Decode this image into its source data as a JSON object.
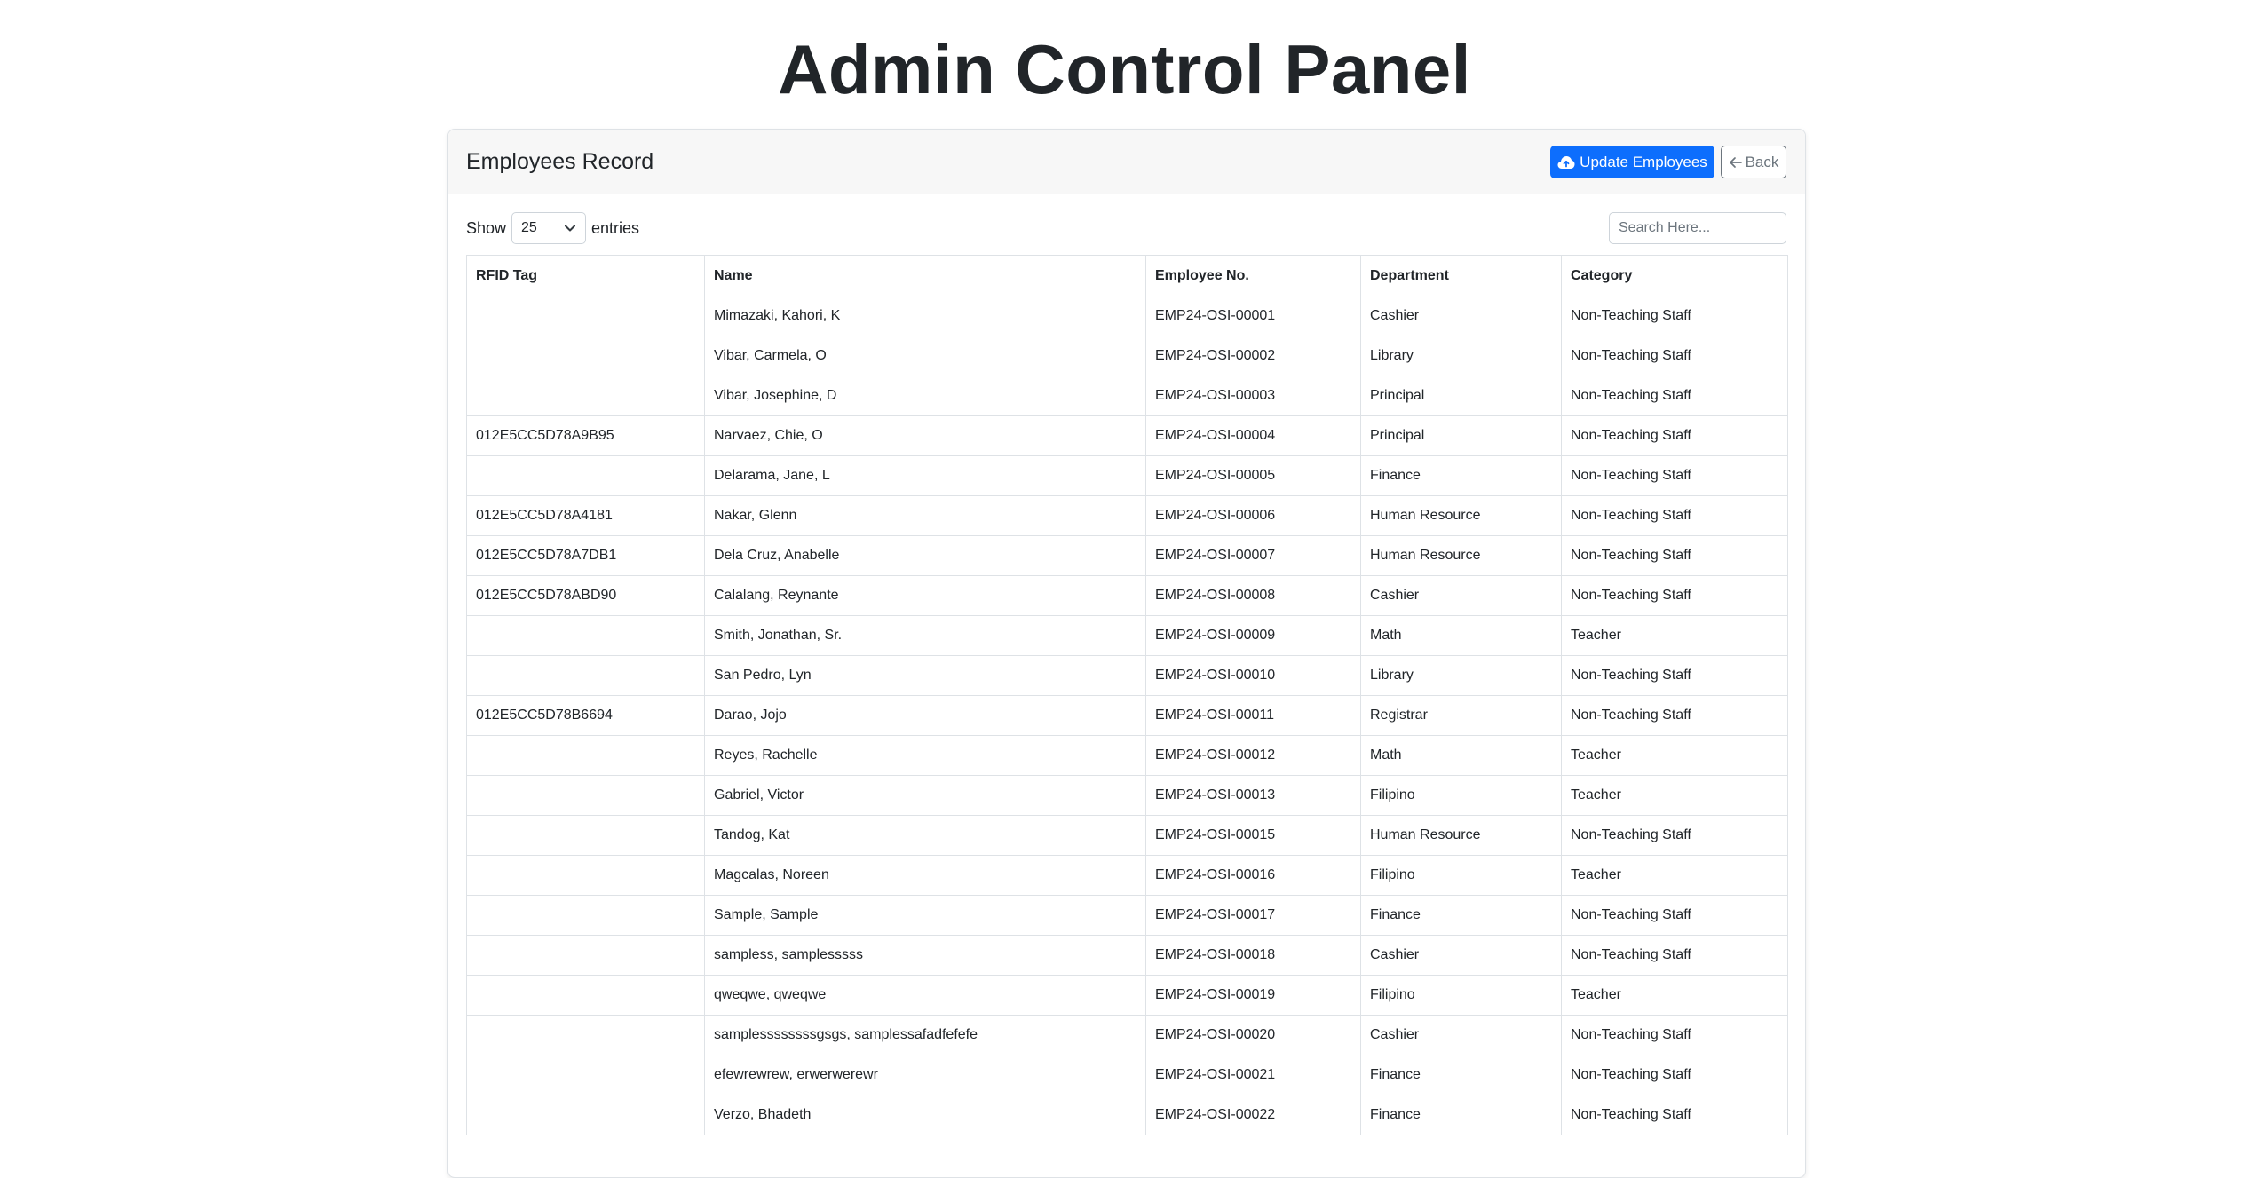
{
  "page": {
    "title": "Admin Control Panel"
  },
  "card": {
    "title": "Employees Record",
    "update_label": "Update Employees",
    "back_label": "Back"
  },
  "length": {
    "show_label": "Show",
    "value": "25",
    "entries_label": "entries"
  },
  "search": {
    "placeholder": "Search Here..."
  },
  "colors": {
    "primary": "#0d6efd",
    "secondary": "#6c757d",
    "header_bg": "#f7f7f7"
  },
  "icons": {
    "update": "cloud-upload-icon",
    "back": "arrow-left-icon",
    "select": "chevron-down-icon"
  },
  "table": {
    "columns": [
      "RFID Tag",
      "Name",
      "Employee No.",
      "Department",
      "Category"
    ],
    "rows": [
      [
        "",
        "Mimazaki, Kahori, K",
        "EMP24-OSI-00001",
        "Cashier",
        "Non-Teaching Staff"
      ],
      [
        "",
        "Vibar, Carmela, O",
        "EMP24-OSI-00002",
        "Library",
        "Non-Teaching Staff"
      ],
      [
        "",
        "Vibar, Josephine, D",
        "EMP24-OSI-00003",
        "Principal",
        "Non-Teaching Staff"
      ],
      [
        "012E5CC5D78A9B95",
        "Narvaez, Chie, O",
        "EMP24-OSI-00004",
        "Principal",
        "Non-Teaching Staff"
      ],
      [
        "",
        "Delarama, Jane, L",
        "EMP24-OSI-00005",
        "Finance",
        "Non-Teaching Staff"
      ],
      [
        "012E5CC5D78A4181",
        "Nakar, Glenn",
        "EMP24-OSI-00006",
        "Human Resource",
        "Non-Teaching Staff"
      ],
      [
        "012E5CC5D78A7DB1",
        "Dela Cruz, Anabelle",
        "EMP24-OSI-00007",
        "Human Resource",
        "Non-Teaching Staff"
      ],
      [
        "012E5CC5D78ABD90",
        "Calalang, Reynante",
        "EMP24-OSI-00008",
        "Cashier",
        "Non-Teaching Staff"
      ],
      [
        "",
        "Smith, Jonathan, Sr.",
        "EMP24-OSI-00009",
        "Math",
        "Teacher"
      ],
      [
        "",
        "San Pedro, Lyn",
        "EMP24-OSI-00010",
        "Library",
        "Non-Teaching Staff"
      ],
      [
        "012E5CC5D78B6694",
        "Darao, Jojo",
        "EMP24-OSI-00011",
        "Registrar",
        "Non-Teaching Staff"
      ],
      [
        "",
        "Reyes, Rachelle",
        "EMP24-OSI-00012",
        "Math",
        "Teacher"
      ],
      [
        "",
        "Gabriel, Victor",
        "EMP24-OSI-00013",
        "Filipino",
        "Teacher"
      ],
      [
        "",
        "Tandog, Kat",
        "EMP24-OSI-00015",
        "Human Resource",
        "Non-Teaching Staff"
      ],
      [
        "",
        "Magcalas, Noreen",
        "EMP24-OSI-00016",
        "Filipino",
        "Teacher"
      ],
      [
        "",
        "Sample, Sample",
        "EMP24-OSI-00017",
        "Finance",
        "Non-Teaching Staff"
      ],
      [
        "",
        "sampless, samplesssss",
        "EMP24-OSI-00018",
        "Cashier",
        "Non-Teaching Staff"
      ],
      [
        "",
        "qweqwe, qweqwe",
        "EMP24-OSI-00019",
        "Filipino",
        "Teacher"
      ],
      [
        "",
        "samplessssssssgsgs, samplessafadfefefe",
        "EMP24-OSI-00020",
        "Cashier",
        "Non-Teaching Staff"
      ],
      [
        "",
        "efewrewrew, erwerwerewr",
        "EMP24-OSI-00021",
        "Finance",
        "Non-Teaching Staff"
      ],
      [
        "",
        "Verzo, Bhadeth",
        "EMP24-OSI-00022",
        "Finance",
        "Non-Teaching Staff"
      ]
    ]
  }
}
